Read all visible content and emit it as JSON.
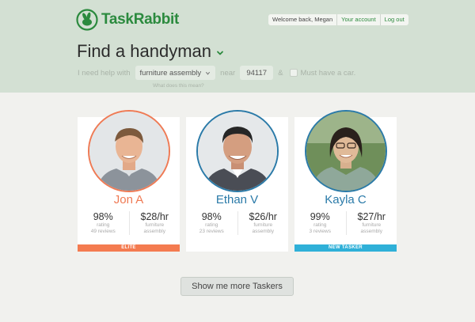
{
  "brand": {
    "name": "TaskRabbit",
    "color": "#2b8a3e"
  },
  "account": {
    "welcome": "Welcome back, Megan",
    "your_account": "Your account",
    "log_out": "Log out"
  },
  "page": {
    "title": "Find a handyman"
  },
  "filters": {
    "prefix": "I need help with",
    "task": "furniture assembly",
    "near": "near",
    "zip": "94117",
    "ampersand": "&",
    "car_label": "Must have a car.",
    "help_link": "What does this mean?"
  },
  "taskers": [
    {
      "name": "Jon A",
      "name_color": "#ef7a54",
      "border_color": "#ef7a54",
      "rating": "98%",
      "rating_label": "rating",
      "reviews": "49 reviews",
      "rate": "$28/hr",
      "rate_label_1": "furniture",
      "rate_label_2": "assembly",
      "badge": "ELITE",
      "badge_color": "#f47b50"
    },
    {
      "name": "Ethan V",
      "name_color": "#2a7aa8",
      "border_color": "#2a7aa8",
      "rating": "98%",
      "rating_label": "rating",
      "reviews": "23 reviews",
      "rate": "$26/hr",
      "rate_label_1": "furniture",
      "rate_label_2": "assembly",
      "badge": "",
      "badge_color": ""
    },
    {
      "name": "Kayla C",
      "name_color": "#2a7aa8",
      "border_color": "#2a7aa8",
      "rating": "99%",
      "rating_label": "rating",
      "reviews": "3 reviews",
      "rate": "$27/hr",
      "rate_label_1": "furniture",
      "rate_label_2": "assembly",
      "badge": "NEW TASKER",
      "badge_color": "#2fb0d8"
    }
  ],
  "more_button": "Show me more Taskers",
  "icons": {
    "logo": "rabbit-logo-icon",
    "title_chevron": "chevron-down-icon",
    "select_arrow": "select-arrow-icon"
  }
}
